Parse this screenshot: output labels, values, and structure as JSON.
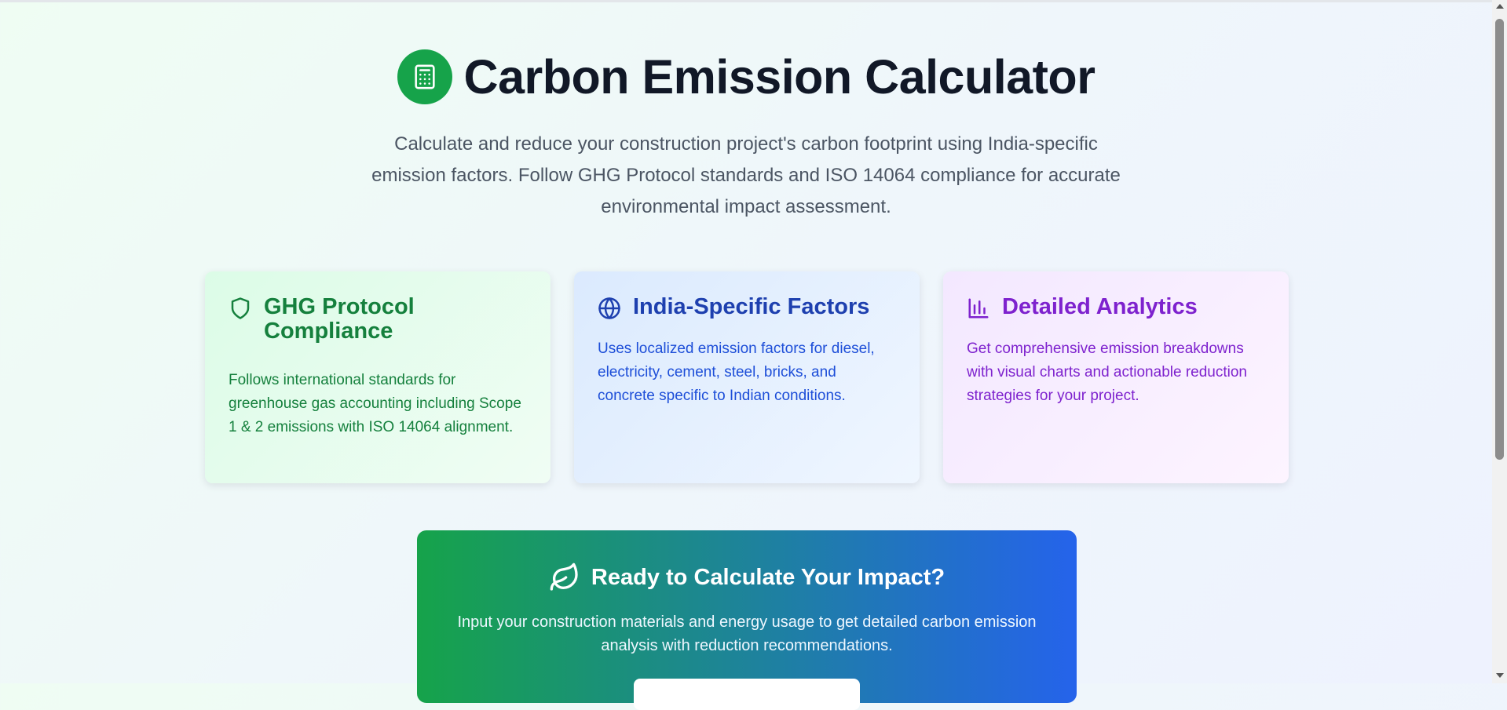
{
  "hero": {
    "icon": "calculator-icon",
    "title": "Carbon Emission Calculator",
    "subtitle": "Calculate and reduce your construction project's carbon footprint using India-specific emission factors. Follow GHG Protocol standards and ISO 14064 compliance for accurate environmental impact assessment."
  },
  "features": [
    {
      "icon": "shield-icon",
      "title": "GHG Protocol Compliance",
      "text": "Follows international standards for greenhouse gas accounting including Scope 1 & 2 emissions with ISO 14064 alignment."
    },
    {
      "icon": "globe-icon",
      "title": "India-Specific Factors",
      "text": "Uses localized emission factors for diesel, electricity, cement, steel, bricks, and concrete specific to Indian conditions."
    },
    {
      "icon": "bar-chart-icon",
      "title": "Detailed Analytics",
      "text": "Get comprehensive emission breakdowns with visual charts and actionable reduction strategies for your project."
    }
  ],
  "cta": {
    "icon": "leaf-icon",
    "title": "Ready to Calculate Your Impact?",
    "text": "Input your construction materials and energy usage to get detailed carbon emission analysis with reduction recommendations."
  },
  "colors": {
    "primary_green": "#16a34a",
    "primary_blue": "#2563eb",
    "heading": "#111827"
  }
}
